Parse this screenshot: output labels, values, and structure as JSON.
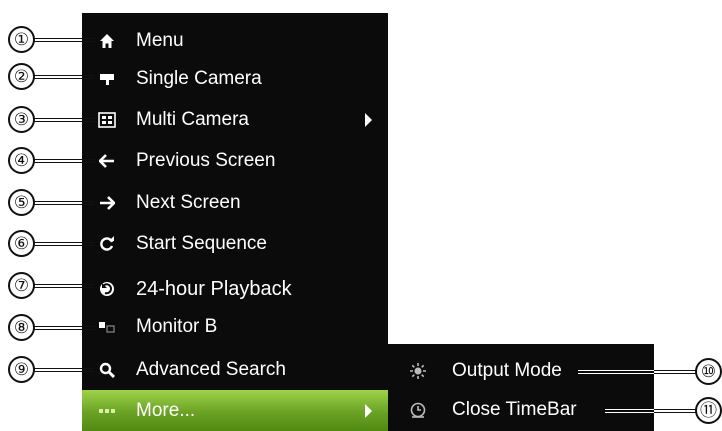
{
  "menu": {
    "items": [
      {
        "label": "Menu",
        "icon": "home-icon"
      },
      {
        "label": "Single Camera",
        "icon": "camera-icon"
      },
      {
        "label": "Multi Camera",
        "icon": "multi-camera-icon",
        "has_submenu": true
      },
      {
        "label": "Previous Screen",
        "icon": "arrow-left-icon"
      },
      {
        "label": "Next Screen",
        "icon": "arrow-right-icon"
      },
      {
        "label": "Start Sequence",
        "icon": "refresh-icon"
      },
      {
        "label": "24-hour Playback",
        "icon": "playback-icon"
      },
      {
        "label": "Monitor B",
        "icon": "monitor-icon"
      },
      {
        "label": "Advanced Search",
        "icon": "search-icon"
      },
      {
        "label": "More...",
        "icon": "more-icon",
        "has_submenu": true,
        "active": true
      }
    ]
  },
  "submenu": {
    "items": [
      {
        "label": "Output Mode",
        "icon": "output-mode-icon"
      },
      {
        "label": "Close TimeBar",
        "icon": "clock-icon"
      }
    ]
  },
  "callouts": [
    "①",
    "②",
    "③",
    "④",
    "⑤",
    "⑥",
    "⑦",
    "⑧",
    "⑨",
    "⑩",
    "⑪"
  ],
  "colors": {
    "menu_bg": "#0b0b0b",
    "active_green": "#6aa224",
    "text": "#ffffff"
  }
}
